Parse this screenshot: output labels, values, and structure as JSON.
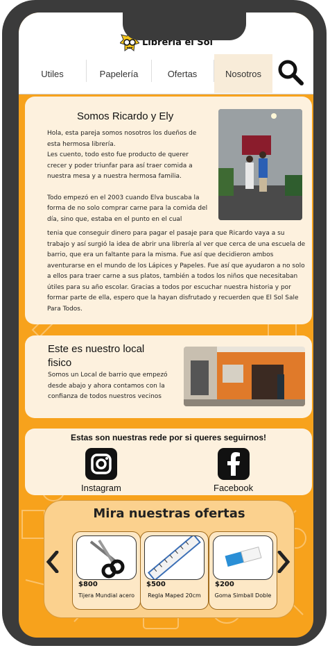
{
  "brand": {
    "name": "Libreria el Sol",
    "logo_icon": "sun-glasses-logo-icon"
  },
  "nav": {
    "items": [
      {
        "label": "Utiles"
      },
      {
        "label": "Papelería"
      },
      {
        "label": "Ofertas"
      },
      {
        "label": "Nosotros",
        "active": true
      }
    ],
    "search_icon": "search-icon"
  },
  "about": {
    "title": "Somos Ricardo y Ely",
    "intro": "Hola, esta pareja somos nosotros los dueños de esta hermosa librería.",
    "intro2": "Les cuento, todo esto fue producto de querer crecer y poder triunfar para así traer comida a nuestra mesa y a nuestra hermosa familia.",
    "story_start": "Todo empezó en el 2003 cuando Elva buscaba la forma de no solo comprar carne para la comida del día, sino que, estaba en el punto en el cual",
    "story_rest": "tenia que conseguir dinero para pagar el pasaje para que Ricardo vaya a su trabajo y así surgió la idea de abrir una librería al ver que cerca de una escuela de barrio, que era un faltante para la misma. Fue así que decidieron ambos aventurarse en el mundo de los Lápices y Papeles. Fue así que ayudaron a no solo a ellos para traer carne a sus platos, también a todos los niños que necesitaban útiles para su año escolar. Gracias a todos por escuchar nuestra historia y por formar parte de ella, espero que la hayan disfrutado y recuerden que El Sol Sale Para Todos."
  },
  "local": {
    "title": "Este es nuestro local fisico",
    "text": "Somos un Local de barrio que empezó desde abajo y ahora contamos con la confianza de todos nuestros vecinos"
  },
  "social": {
    "title": "Estas son nuestras rede por si queres seguirnos!",
    "items": [
      {
        "label": "Instagram",
        "icon": "instagram-icon"
      },
      {
        "label": "Facebook",
        "icon": "facebook-icon"
      }
    ]
  },
  "offers": {
    "title": "Mira nuestras ofertas",
    "products": [
      {
        "price": "$800",
        "name": "Tijera Mundial acero",
        "icon": "scissors-icon"
      },
      {
        "price": "$500",
        "name": "Regla Maped 20cm",
        "icon": "ruler-icon"
      },
      {
        "price": "$200",
        "name": "Goma Simball Doble",
        "icon": "eraser-icon"
      }
    ]
  },
  "colors": {
    "background": "#f7a21c",
    "card": "#fdf1de",
    "offers_panel": "#fbd18e",
    "frame": "#3b3b3b"
  }
}
